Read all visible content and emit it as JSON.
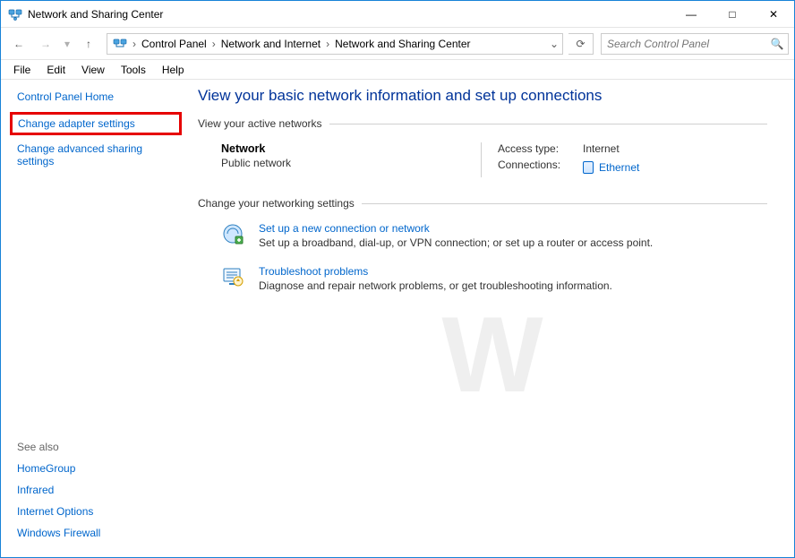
{
  "window": {
    "title": "Network and Sharing Center"
  },
  "nav": {
    "breadcrumbs": [
      "Control Panel",
      "Network and Internet",
      "Network and Sharing Center"
    ],
    "search_placeholder": "Search Control Panel"
  },
  "menu": [
    "File",
    "Edit",
    "View",
    "Tools",
    "Help"
  ],
  "sidebar": {
    "items": [
      {
        "label": "Control Panel Home"
      },
      {
        "label": "Change adapter settings",
        "highlighted": true
      },
      {
        "label": "Change advanced sharing settings"
      }
    ],
    "see_also_header": "See also",
    "see_also": [
      "HomeGroup",
      "Infrared",
      "Internet Options",
      "Windows Firewall"
    ]
  },
  "main": {
    "heading": "View your basic network information and set up connections",
    "active_networks_label": "View your active networks",
    "network": {
      "name": "Network",
      "type": "Public network",
      "access_type_label": "Access type:",
      "access_type_value": "Internet",
      "connections_label": "Connections:",
      "connections_value": "Ethernet"
    },
    "change_settings_label": "Change your networking settings",
    "settings": [
      {
        "title": "Set up a new connection or network",
        "desc": "Set up a broadband, dial-up, or VPN connection; or set up a router or access point."
      },
      {
        "title": "Troubleshoot problems",
        "desc": "Diagnose and repair network problems, or get troubleshooting information."
      }
    ]
  },
  "icons": {
    "app": "network-sharing-icon",
    "back": "←",
    "forward": "→",
    "recent_drop": "▾",
    "up": "↑",
    "crumb_sep": "›",
    "addr_drop": "⌄",
    "refresh": "⟳",
    "search": "🔍",
    "min": "—",
    "max": "□",
    "close": "✕"
  }
}
